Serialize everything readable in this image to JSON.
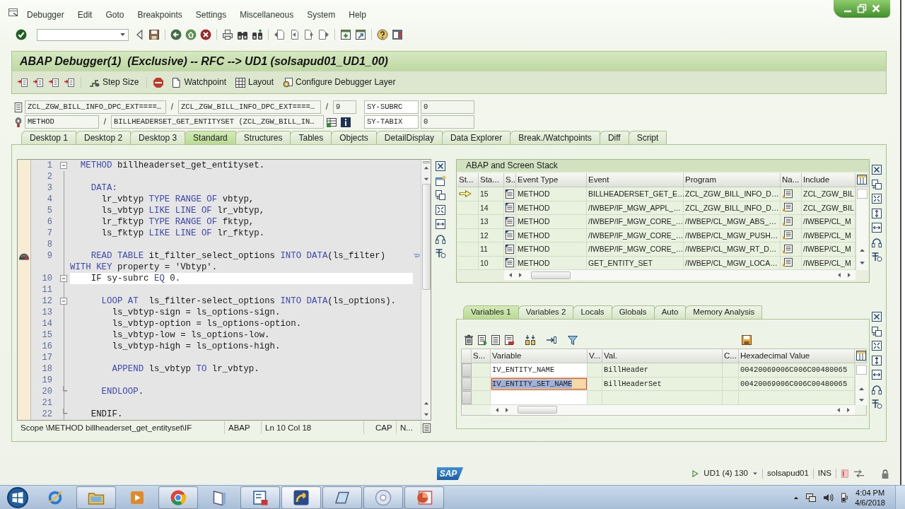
{
  "window": {
    "title": "ABAP Debugger(1)  (Exclusive) -- RFC --> UD1 (solsapud01_UD1_00)"
  },
  "menu_bar": [
    "Debugger",
    "Edit",
    "Goto",
    "Breakpoints",
    "Settings",
    "Miscellaneous",
    "System",
    "Help"
  ],
  "app_toolbar": {
    "buttons": [
      {
        "label": "Step Size"
      },
      {
        "label": "Watchpoint"
      },
      {
        "label": "Layout"
      },
      {
        "label": "Configure Debugger Layer"
      }
    ]
  },
  "context": {
    "location": [
      {
        "kind": "field",
        "value": "ZCL_ZGW_BILL_INFO_DPC_EXT====…"
      },
      {
        "kind": "separator",
        "text": "/"
      },
      {
        "kind": "field",
        "value": "ZCL_ZGW_BILL_INFO_DPC_EXT====…"
      },
      {
        "kind": "separator",
        "text": "/"
      },
      {
        "kind": "field",
        "value": "9"
      }
    ],
    "event": [
      {
        "kind": "field",
        "value": "METHOD"
      },
      {
        "kind": "separator",
        "text": "/"
      },
      {
        "kind": "field",
        "value": "BILLHEADERSET_GET_ENTITYSET (ZCL_ZGW_BILL_IN…"
      }
    ],
    "system_fields": [
      {
        "name": "SY-SUBRC",
        "value": "0"
      },
      {
        "name": "SY-TABIX",
        "value": "0"
      }
    ]
  },
  "tabs": [
    {
      "label": "Desktop 1",
      "selected": false
    },
    {
      "label": "Desktop 2",
      "selected": false
    },
    {
      "label": "Desktop 3",
      "selected": false
    },
    {
      "label": "Standard",
      "selected": true
    },
    {
      "label": "Structures",
      "selected": false
    },
    {
      "label": "Tables",
      "selected": false
    },
    {
      "label": "Objects",
      "selected": false
    },
    {
      "label": "DetailDisplay",
      "selected": false
    },
    {
      "label": "Data Explorer",
      "selected": false
    },
    {
      "label": "Break./Watchpoints",
      "selected": false
    },
    {
      "label": "Diff",
      "selected": false
    },
    {
      "label": "Script",
      "selected": false
    }
  ],
  "source": {
    "lines": [
      {
        "number": "1",
        "kind": "block_start",
        "breakpoint": false,
        "current": false,
        "tokens": [
          {
            "text": "  METHOD",
            "kind": "keyword"
          },
          {
            "text": " billheaderset_get_entityset.",
            "kind": "text"
          }
        ]
      },
      {
        "number": "2",
        "kind": "plain",
        "breakpoint": false,
        "current": false
      },
      {
        "number": "3",
        "kind": "plain",
        "breakpoint": false,
        "current": false,
        "tokens": [
          {
            "text": "    DATA:",
            "kind": "keyword"
          }
        ]
      },
      {
        "number": "4",
        "kind": "plain",
        "breakpoint": false,
        "current": false,
        "tokens": [
          {
            "text": "      lr_vbtyp ",
            "kind": "text"
          },
          {
            "text": "TYPE RANGE OF",
            "kind": "keyword"
          },
          {
            "text": " vbtyp,",
            "kind": "text"
          }
        ]
      },
      {
        "number": "5",
        "kind": "plain",
        "breakpoint": false,
        "current": false,
        "tokens": [
          {
            "text": "      ls_vbtyp ",
            "kind": "text"
          },
          {
            "text": "LIKE LINE OF",
            "kind": "keyword"
          },
          {
            "text": " lr_vbtyp,",
            "kind": "text"
          }
        ]
      },
      {
        "number": "6",
        "kind": "plain",
        "breakpoint": false,
        "current": false,
        "tokens": [
          {
            "text": "      lr_fktyp ",
            "kind": "text"
          },
          {
            "text": "TYPE RANGE OF",
            "kind": "keyword"
          },
          {
            "text": " fktyp,",
            "kind": "text"
          }
        ]
      },
      {
        "number": "7",
        "kind": "plain",
        "breakpoint": false,
        "current": false,
        "tokens": [
          {
            "text": "      ls_fktyp ",
            "kind": "text"
          },
          {
            "text": "LIKE LINE OF",
            "kind": "keyword"
          },
          {
            "text": " lr_fktyp.",
            "kind": "text"
          }
        ]
      },
      {
        "number": "8",
        "kind": "plain",
        "breakpoint": false,
        "current": false
      },
      {
        "number": "9",
        "kind": "plain",
        "breakpoint": true,
        "current": false,
        "tokens": [
          {
            "text": "    READ TABLE",
            "kind": "keyword"
          },
          {
            "text": " it_filter_select_options ",
            "kind": "text"
          },
          {
            "text": "INTO DATA",
            "kind": "keyword"
          },
          {
            "text": "(ls_filter)",
            "kind": "text"
          }
        ],
        "continuation": [
          {
            "text": "WITH KEY",
            "kind": "keyword"
          },
          {
            "text": " property = 'Vbtyp'.",
            "kind": "text"
          }
        ]
      },
      {
        "number": "10",
        "kind": "block_start",
        "breakpoint": false,
        "current": true,
        "tokens": [
          {
            "text": "    IF sy-subrc ",
            "kind": "text"
          },
          {
            "text": "EQ",
            "kind": "keyword"
          },
          {
            "text": " 0.",
            "kind": "text"
          }
        ]
      },
      {
        "number": "11",
        "kind": "plain",
        "breakpoint": false,
        "current": false
      },
      {
        "number": "12",
        "kind": "block_start",
        "breakpoint": false,
        "current": false,
        "tokens": [
          {
            "text": "      LOOP AT",
            "kind": "keyword"
          },
          {
            "text": "  ls_filter-select_options ",
            "kind": "text"
          },
          {
            "text": "INTO DATA",
            "kind": "keyword"
          },
          {
            "text": "(ls_options).",
            "kind": "text"
          }
        ]
      },
      {
        "number": "13",
        "kind": "plain",
        "breakpoint": false,
        "current": false,
        "tokens": [
          {
            "text": "        ls_vbtyp-sign = ls_options-sign.",
            "kind": "text"
          }
        ]
      },
      {
        "number": "14",
        "kind": "plain",
        "breakpoint": false,
        "current": false,
        "tokens": [
          {
            "text": "        ls_vbtyp-option = ls_options-option.",
            "kind": "text"
          }
        ]
      },
      {
        "number": "15",
        "kind": "plain",
        "breakpoint": false,
        "current": false,
        "tokens": [
          {
            "text": "        ls_vbtyp-low = ls_options-low.",
            "kind": "text"
          }
        ]
      },
      {
        "number": "16",
        "kind": "plain",
        "breakpoint": false,
        "current": false,
        "tokens": [
          {
            "text": "        ls_vbtyp-high = ls_options-high.",
            "kind": "text"
          }
        ]
      },
      {
        "number": "17",
        "kind": "plain",
        "breakpoint": false,
        "current": false
      },
      {
        "number": "18",
        "kind": "plain",
        "breakpoint": false,
        "current": false,
        "tokens": [
          {
            "text": "        APPEND",
            "kind": "keyword"
          },
          {
            "text": " ls_vbtyp ",
            "kind": "text"
          },
          {
            "text": "TO",
            "kind": "keyword"
          },
          {
            "text": " lr_vbtyp.",
            "kind": "text"
          }
        ]
      },
      {
        "number": "19",
        "kind": "plain",
        "breakpoint": false,
        "current": false
      },
      {
        "number": "20",
        "kind": "block_end",
        "breakpoint": false,
        "current": false,
        "tokens": [
          {
            "text": "      ENDLOOP",
            "kind": "keyword"
          },
          {
            "text": ".",
            "kind": "text"
          }
        ]
      },
      {
        "number": "21",
        "kind": "plain",
        "breakpoint": false,
        "current": false
      },
      {
        "number": "22",
        "kind": "block_end",
        "breakpoint": false,
        "current": false,
        "tokens": [
          {
            "text": "    ENDIF.",
            "kind": "text"
          }
        ]
      }
    ],
    "status": {
      "scope": "Scope \\METHOD billheaderset_get_entityset\\IF",
      "language": "ABAP",
      "position": "Ln 10 Col 18",
      "caps": "CAP",
      "mode": "N..."
    }
  },
  "stack": {
    "title": "ABAP and Screen Stack",
    "columns": [
      "St...",
      "Sta...",
      "S..",
      "Event Type",
      "Event",
      "Program",
      "Na...",
      "Include"
    ],
    "rows": [
      {
        "current": true,
        "number": "15",
        "event_type": "METHOD",
        "event": "BILLHEADERSET_GET_E…",
        "program": "ZCL_ZGW_BILL_INFO_D…",
        "include": "ZCL_ZGW_BIL"
      },
      {
        "current": false,
        "number": "14",
        "event_type": "METHOD",
        "event": "/IWBEP/IF_MGW_APPL_…",
        "program": "ZCL_ZGW_BILL_INFO_D…",
        "include": "ZCL_ZGW_BIL"
      },
      {
        "current": false,
        "number": "13",
        "event_type": "METHOD",
        "event": "/IWBEP/IF_MGW_CORE_…",
        "program": "/IWBEP/CL_MGW_ABS_…",
        "include": "/IWBEP/CL_M"
      },
      {
        "current": false,
        "number": "12",
        "event_type": "METHOD",
        "event": "/IWBEP/IF_MGW_CORE_…",
        "program": "/IWBEP/CL_MGW_PUSH…",
        "include": "/IWBEP/CL_M"
      },
      {
        "current": false,
        "number": "11",
        "event_type": "METHOD",
        "event": "/IWBEP/IF_MGW_CORE_…",
        "program": "/IWBEP/CL_MGW_RT_D…",
        "include": "/IWBEP/CL_M"
      },
      {
        "current": false,
        "number": "10",
        "event_type": "METHOD",
        "event": "GET_ENTITY_SET",
        "program": "/IWBEP/CL_MGW_LOCA…",
        "include": "/IWBEP/CL_M"
      }
    ]
  },
  "variables": {
    "tabs": [
      {
        "label": "Variables 1",
        "selected": true
      },
      {
        "label": "Variables 2",
        "selected": false
      },
      {
        "label": "Locals",
        "selected": false
      },
      {
        "label": "Globals",
        "selected": false
      },
      {
        "label": "Auto",
        "selected": false
      },
      {
        "label": "Memory Analysis",
        "selected": false
      }
    ],
    "columns": [
      "S...",
      "Variable",
      "V...",
      "Val.",
      "C...",
      "Hexadecimal Value"
    ],
    "rows": [
      {
        "selected": false,
        "variable": "IV_ENTITY_NAME",
        "value": "BillHeader",
        "hex": "00420069006C006C00480065"
      },
      {
        "selected": true,
        "variable": "IV_ENTITY_SET_NAME",
        "value": "BillHeaderSet",
        "hex": "00420069006C006C00480065"
      }
    ]
  },
  "sap_status": {
    "logo": "SAP",
    "system": "UD1 (4) 130",
    "server": "solsapud01",
    "mode": "INS"
  },
  "taskbar": {
    "apps": [
      {
        "running": false,
        "selected": false
      },
      {
        "running": true,
        "selected": false
      },
      {
        "running": false,
        "selected": false
      },
      {
        "running": true,
        "selected": false
      },
      {
        "running": false,
        "selected": false
      },
      {
        "running": true,
        "selected": false
      },
      {
        "running": true,
        "selected": true
      },
      {
        "running": true,
        "selected": false
      },
      {
        "running": true,
        "selected": false
      },
      {
        "running": true,
        "selected": false
      }
    ],
    "clock": {
      "time": "4:04 PM",
      "date": "4/6/2018"
    }
  }
}
